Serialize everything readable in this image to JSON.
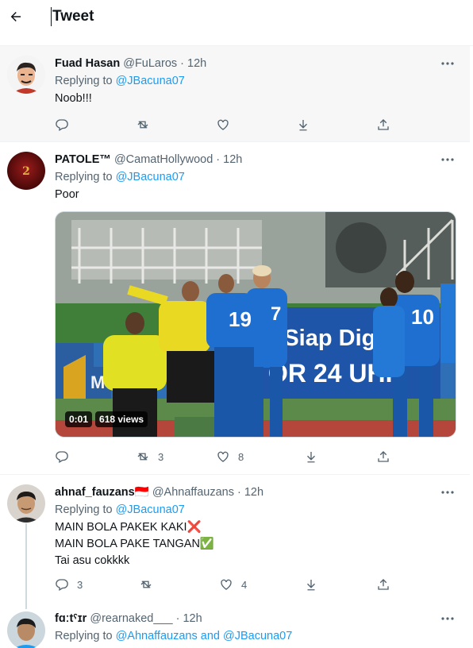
{
  "header": {
    "title": "Tweet"
  },
  "tweets": [
    {
      "name": "Fuad Hasan",
      "handle": "@FuLaros",
      "sep": "·",
      "time": "12h",
      "replying_prefix": "Replying to",
      "replying_to": "@JBacuna07",
      "text": "Noob!!!",
      "actions": {
        "replies": "",
        "retweets": "",
        "likes": ""
      }
    },
    {
      "name": "PATOLE™",
      "handle": "@CamatHollywood",
      "sep": "·",
      "time": "12h",
      "replying_prefix": "Replying to",
      "replying_to": "@JBacuna07",
      "text": "Poor",
      "media": {
        "duration": "0:01",
        "views": "618 views",
        "banner_line1": "r Siap Digital",
        "banner_line2": "OR 24 UHF",
        "jersey_a": "19",
        "jersey_b": "7",
        "jersey_c": "10",
        "left_board": "M"
      },
      "actions": {
        "replies": "",
        "retweets": "3",
        "likes": "8"
      }
    },
    {
      "name": "ahnaf_fauzans🇮🇩",
      "handle": "@Ahnaffauzans",
      "sep": "·",
      "time": "12h",
      "replying_prefix": "Replying to",
      "replying_to": "@JBacuna07",
      "lines": [
        "MAIN BOLA PAKEK KAKI❌",
        "MAIN BOLA PAKE TANGAN✅",
        "Tai asu cokkkk"
      ],
      "actions": {
        "replies": "3",
        "retweets": "",
        "likes": "4"
      }
    },
    {
      "name": "fɑːtˤɪr",
      "handle": "@rearnaked___",
      "sep": "·",
      "time": "12h",
      "replying_prefix": "Replying to",
      "replying_to": "@Ahnaffauzans",
      "replying_and": "and",
      "replying_to_2": "@JBacuna07"
    }
  ],
  "colors": {
    "accent": "#1d9bf0",
    "secondary_text": "#536471",
    "highlight_bg": "#f7f7f7"
  },
  "icons": [
    "back-arrow-icon",
    "more-icon",
    "reply-icon",
    "retweet-icon",
    "like-icon",
    "download-icon",
    "share-icon"
  ]
}
